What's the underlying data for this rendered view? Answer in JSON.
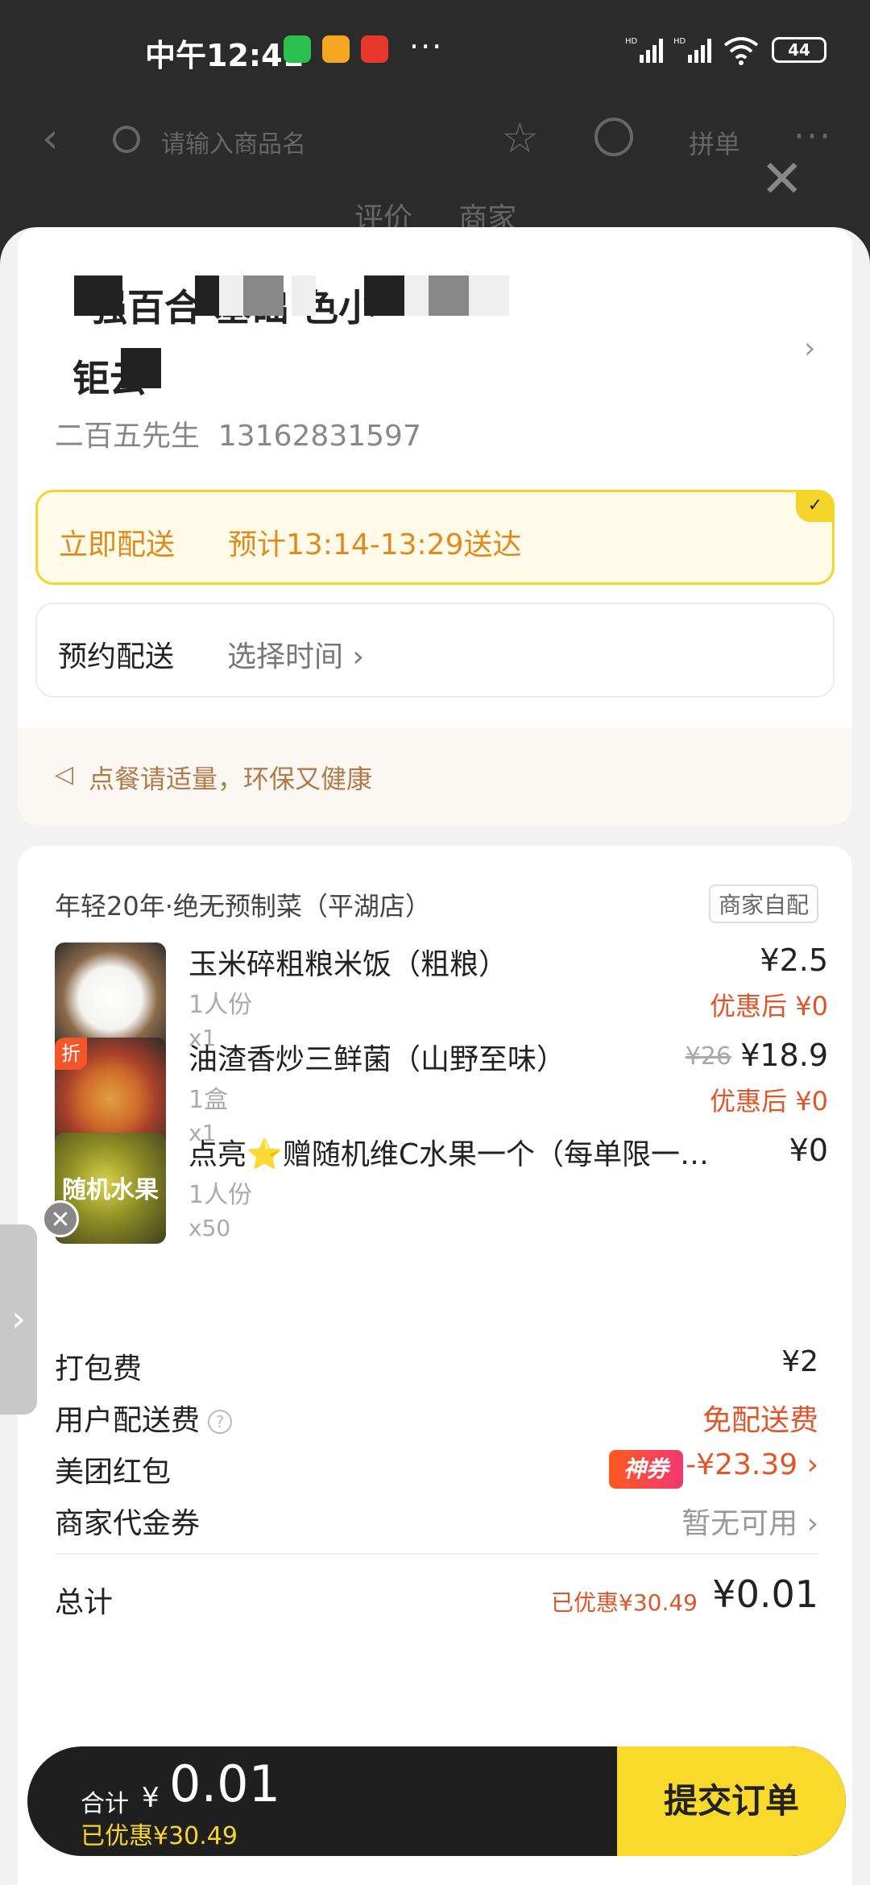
{
  "status_bar": {
    "time": "中午12:41",
    "dots": "···",
    "battery": "44",
    "signal1": "HD",
    "signal2": "HD"
  },
  "header_bg": {
    "search_placeholder": "请输入商品名",
    "pin_label": "拼单",
    "tab1": "评价",
    "tab2": "商家"
  },
  "address": {
    "line1": "强百合  基础    色小",
    "line2": "钜云",
    "contact_name": "二百五先生",
    "contact_phone": "13162831597"
  },
  "delivery": {
    "now_label": "立即配送",
    "now_eta": "预计13:14-13:29送达",
    "schedule_label": "预约配送",
    "schedule_value": "选择时间 ›"
  },
  "tip": {
    "text": "点餐请适量，环保又健康"
  },
  "shop": {
    "name": "年轻20年·绝无预制菜（平湖店）",
    "badge": "商家自配"
  },
  "items": [
    {
      "name": "玉米碎粗粮米饭（粗粮）",
      "spec": "1人份",
      "qty": "x1",
      "price": "¥2.5",
      "disc": "优惠后 ¥0"
    },
    {
      "name": "油渣香炒三鲜菌（山野至味）",
      "spec": "1盒",
      "qty": "x1",
      "price_old": "¥26",
      "price": "¥18.9",
      "disc": "优惠后 ¥0",
      "tag": "折"
    },
    {
      "name": "点亮⭐赠随机维C水果一个（每单限一…",
      "spec": "1人份",
      "qty": "x50",
      "price": "¥0",
      "thumb_text": "随机水果"
    }
  ],
  "fees": {
    "pack_label": "打包费",
    "pack_val": "¥2",
    "ship_label": "用户配送费",
    "ship_val": "免配送费",
    "red_label": "美团红包",
    "red_tag": "神券",
    "red_val": "-¥23.39 ›",
    "voucher_label": "商家代金券",
    "voucher_val": "暂无可用 ›",
    "subtotal_label": "总计",
    "subtotal_saved": "已优惠¥30.49",
    "subtotal_val": "¥0.01"
  },
  "bottom": {
    "total_label": "合计",
    "currency": "¥",
    "total": "0.01",
    "saved": "已优惠¥30.49",
    "submit": "提交订单"
  },
  "colors": {
    "accent_yellow": "#f9d92c",
    "orange": "#e08a1e",
    "red": "#e0552a"
  }
}
